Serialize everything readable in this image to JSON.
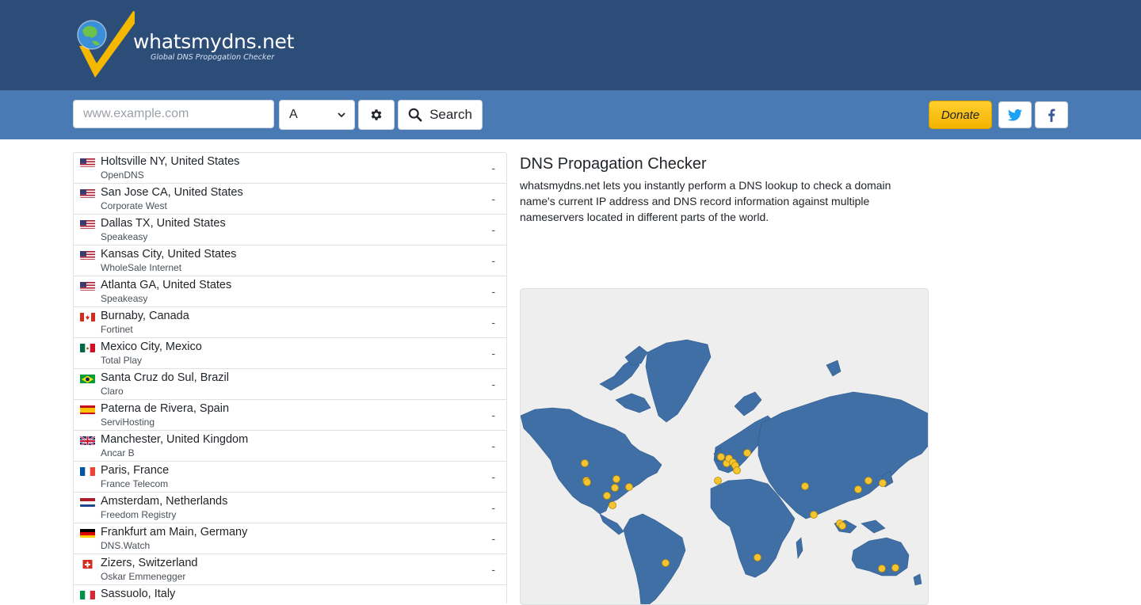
{
  "brand": {
    "name": "whatsmydns.net",
    "tagline": "Global DNS Propogation Checker"
  },
  "toolbar": {
    "search_placeholder": "www.example.com",
    "search_value": "",
    "record_type": "A",
    "search_label": "Search",
    "donate_label": "Donate"
  },
  "servers": [
    {
      "location": "Holtsville NY, United States",
      "provider": "OpenDNS",
      "flag": "us",
      "result": "-"
    },
    {
      "location": "San Jose CA, United States",
      "provider": "Corporate West",
      "flag": "us",
      "result": "-"
    },
    {
      "location": "Dallas TX, United States",
      "provider": "Speakeasy",
      "flag": "us",
      "result": "-"
    },
    {
      "location": "Kansas City, United States",
      "provider": "WholeSale Internet",
      "flag": "us",
      "result": "-"
    },
    {
      "location": "Atlanta GA, United States",
      "provider": "Speakeasy",
      "flag": "us",
      "result": "-"
    },
    {
      "location": "Burnaby, Canada",
      "provider": "Fortinet",
      "flag": "ca",
      "result": "-"
    },
    {
      "location": "Mexico City, Mexico",
      "provider": "Total Play",
      "flag": "mx",
      "result": "-"
    },
    {
      "location": "Santa Cruz do Sul, Brazil",
      "provider": "Claro",
      "flag": "br",
      "result": "-"
    },
    {
      "location": "Paterna de Rivera, Spain",
      "provider": "ServiHosting",
      "flag": "es",
      "result": "-"
    },
    {
      "location": "Manchester, United Kingdom",
      "provider": "Ancar B",
      "flag": "gb",
      "result": "-"
    },
    {
      "location": "Paris, France",
      "provider": "France Telecom",
      "flag": "fr",
      "result": "-"
    },
    {
      "location": "Amsterdam, Netherlands",
      "provider": "Freedom Registry",
      "flag": "nl",
      "result": "-"
    },
    {
      "location": "Frankfurt am Main, Germany",
      "provider": "DNS.Watch",
      "flag": "de",
      "result": "-"
    },
    {
      "location": "Zizers, Switzerland",
      "provider": "Oskar Emmenegger",
      "flag": "ch",
      "result": "-"
    },
    {
      "location": "Sassuolo, Italy",
      "provider": "",
      "flag": "it",
      "result": ""
    }
  ],
  "main": {
    "title": "DNS Propagation Checker",
    "description": "whatsmydns.net lets you instantly perform a DNS lookup to check a domain name's current IP address and DNS record information against multiple nameservers located in different parts of the world."
  },
  "colors": {
    "header_bg": "#2c4d78",
    "toolbar_bg": "#4a7ab4",
    "map_land": "#3f6fa5",
    "marker": "#f5c431",
    "donate": "#f4b400"
  }
}
